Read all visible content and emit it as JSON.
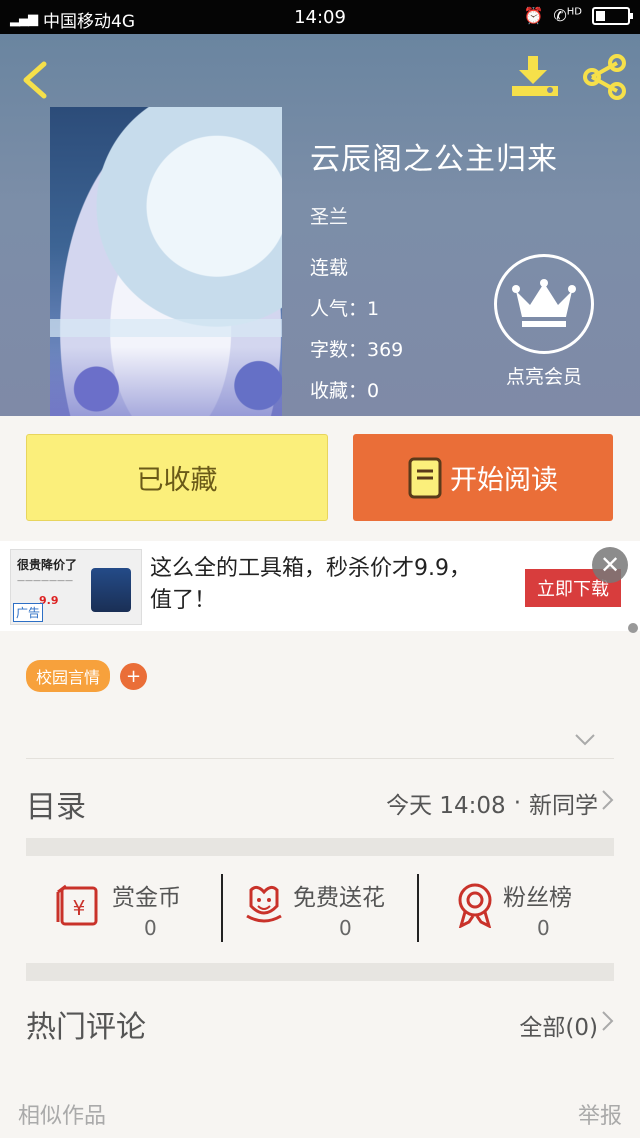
{
  "status_bar": {
    "signal": "4G",
    "carrier": "中国移动4G",
    "time": "14:09",
    "hd": "HD"
  },
  "book": {
    "title": "云辰阁之公主归来",
    "author": "圣兰",
    "status": "连载",
    "popularity": "人气：1",
    "word_count": "字数：369",
    "favorites": "收藏：0",
    "vip_label": "点亮会员"
  },
  "actions": {
    "favorited_label": "已收藏",
    "start_read_label": "开始阅读"
  },
  "ad": {
    "thumb_title": "很贵降价了",
    "thumb_price": "9.9",
    "thumb_tag": "广告",
    "text": "这么全的工具箱，秒杀价才9.9，值了！",
    "cta": "立即下载"
  },
  "tags": {
    "items": [
      "校园言情"
    ],
    "add": "+"
  },
  "catalog": {
    "title": "目录",
    "update_time": "今天 14:08",
    "separator": "·",
    "latest_chapter": "新同学"
  },
  "stats": {
    "reward": {
      "label": "赏金币",
      "value": "0"
    },
    "flower": {
      "label": "免费送花",
      "value": "0"
    },
    "fans": {
      "label": "粉丝榜",
      "value": "0"
    }
  },
  "comments": {
    "title": "热门评论",
    "all": "全部(0)"
  },
  "footer": {
    "similar": "相似作品",
    "report": "举报"
  },
  "colors": {
    "accent_orange": "#ea6e38",
    "favorite_yellow": "#fbef7b",
    "tag_orange": "#f7a13c",
    "icon_red": "#c9322a"
  }
}
